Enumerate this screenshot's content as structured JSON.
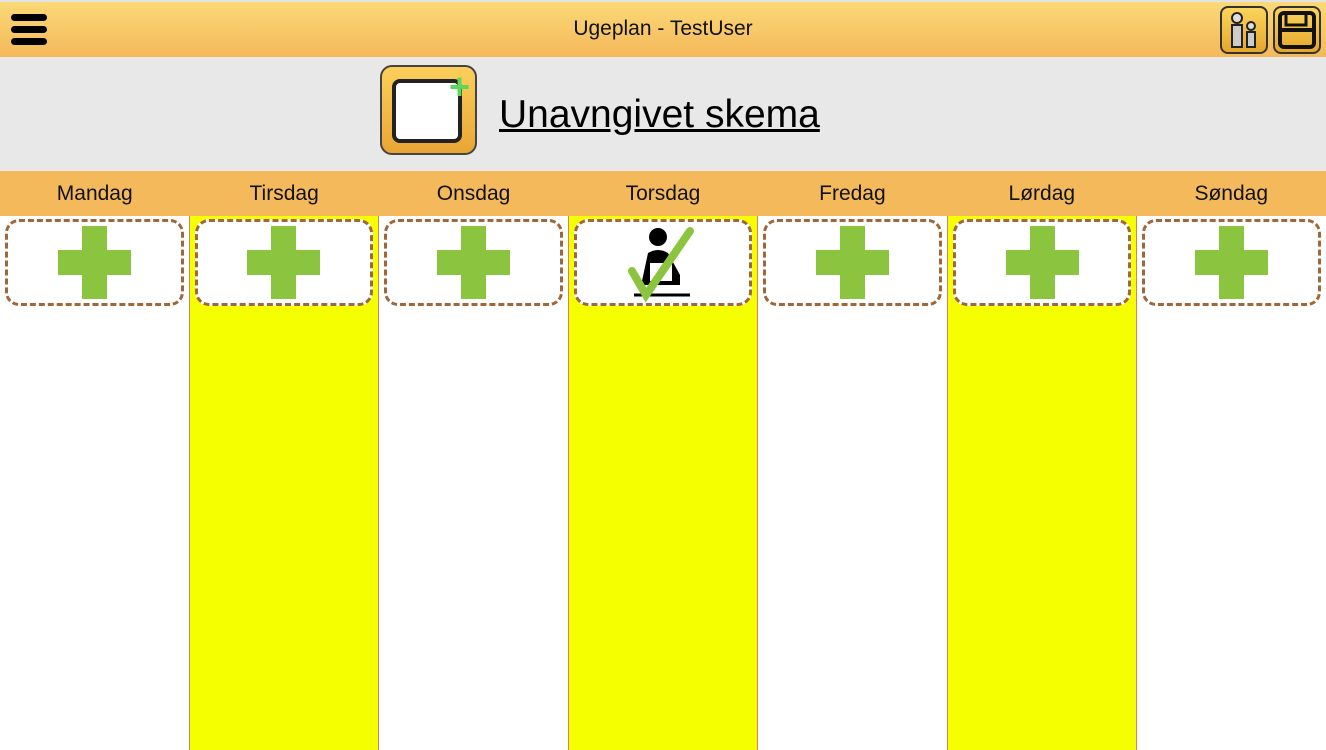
{
  "header": {
    "title": "Ugeplan - TestUser",
    "menu_icon": "hamburger-icon",
    "users_icon": "users-icon",
    "save_icon": "floppy-disk-icon"
  },
  "schedule": {
    "name": "Unavngivet skema",
    "new_icon": "new-schedule-icon"
  },
  "days": [
    {
      "label": "Mandag",
      "highlight": false,
      "activity": "add"
    },
    {
      "label": "Tirsdag",
      "highlight": true,
      "activity": "add"
    },
    {
      "label": "Onsdag",
      "highlight": false,
      "activity": "add"
    },
    {
      "label": "Torsdag",
      "highlight": true,
      "activity": "completed-task"
    },
    {
      "label": "Fredag",
      "highlight": false,
      "activity": "add"
    },
    {
      "label": "Lørdag",
      "highlight": true,
      "activity": "add"
    },
    {
      "label": "Søndag",
      "highlight": false,
      "activity": "add"
    }
  ],
  "colors": {
    "highlight": "#f6ff00",
    "header": "#f4b95b",
    "add": "#8bc53f"
  }
}
